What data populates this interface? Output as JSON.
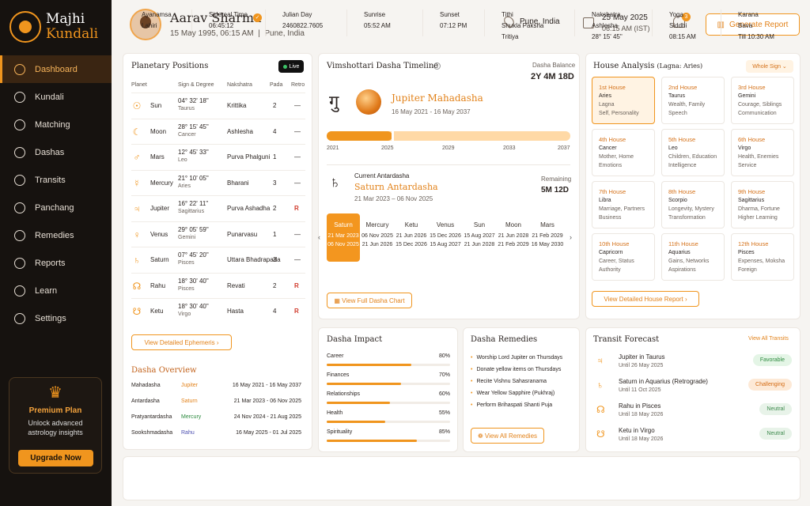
{
  "brand": {
    "line1": "Majhi",
    "line2": "Kundali"
  },
  "nav": [
    {
      "label": "Dashboard"
    },
    {
      "label": "Kundali"
    },
    {
      "label": "Matching"
    },
    {
      "label": "Dashas"
    },
    {
      "label": "Transits"
    },
    {
      "label": "Panchang"
    },
    {
      "label": "Remedies"
    },
    {
      "label": "Reports"
    },
    {
      "label": "Learn"
    },
    {
      "label": "Settings"
    }
  ],
  "premium": {
    "title": "Premium Plan",
    "sub1": "Unlock advanced",
    "sub2": "astrology insights",
    "btn": "Upgrade Now"
  },
  "user": {
    "name": "Aarav Sharma",
    "dob": "15 May 1995, 06:15 AM",
    "place": "Pune, India"
  },
  "header": {
    "location": "Pune, India",
    "date": "25 May 2025",
    "time": "06:15 AM (IST)",
    "notif": "3",
    "report_btn": "Generate Report"
  },
  "planets": {
    "title": "Planetary Positions",
    "live": "Live",
    "cols": [
      "Planet",
      "Sign & Degree",
      "Nakshatra",
      "Pada",
      "Retro"
    ],
    "rows": [
      {
        "icon": "☉",
        "name": "Sun",
        "deg": "04° 32' 18\"",
        "sign": "Taurus",
        "nak": "Krittika",
        "pada": "2",
        "retro": "—"
      },
      {
        "icon": "☾",
        "name": "Moon",
        "deg": "28° 15' 45\"",
        "sign": "Cancer",
        "nak": "Ashlesha",
        "pada": "4",
        "retro": "—"
      },
      {
        "icon": "♂",
        "name": "Mars",
        "deg": "12° 45' 33\"",
        "sign": "Leo",
        "nak": "Purva Phalguni",
        "pada": "1",
        "retro": "—"
      },
      {
        "icon": "☿",
        "name": "Mercury",
        "deg": "21° 10' 05\"",
        "sign": "Aries",
        "nak": "Bharani",
        "pada": "3",
        "retro": "—"
      },
      {
        "icon": "♃",
        "name": "Jupiter",
        "deg": "16° 22' 11\"",
        "sign": "Sagittarius",
        "nak": "Purva Ashadha",
        "pada": "2",
        "retro": "R"
      },
      {
        "icon": "♀",
        "name": "Venus",
        "deg": "29° 05' 59\"",
        "sign": "Gemini",
        "nak": "Punarvasu",
        "pada": "1",
        "retro": "—"
      },
      {
        "icon": "♄",
        "name": "Saturn",
        "deg": "07° 45' 20\"",
        "sign": "Pisces",
        "nak": "Uttara Bhadrapada",
        "pada": "3",
        "retro": "—"
      },
      {
        "icon": "☊",
        "name": "Rahu",
        "deg": "18° 30' 40\"",
        "sign": "Pisces",
        "nak": "Revati",
        "pada": "2",
        "retro": "R"
      },
      {
        "icon": "☋",
        "name": "Ketu",
        "deg": "18° 30' 40\"",
        "sign": "Virgo",
        "nak": "Hasta",
        "pada": "4",
        "retro": "R"
      }
    ],
    "ephem_btn": "View Detailed Ephemeris"
  },
  "overview": {
    "title": "Dasha Overview",
    "rows": [
      {
        "k": "Mahadasha",
        "p": "Jupiter",
        "d": "16 May 2021 - 16 May 2037",
        "c": "#e2821a"
      },
      {
        "k": "Antardasha",
        "p": "Saturn",
        "d": "21 Mar 2023 - 06 Nov 2025",
        "c": "#e2821a"
      },
      {
        "k": "Pratyantardasha",
        "p": "Mercury",
        "d": "24 Nov 2024 - 21 Aug 2025",
        "c": "#2d8a3f"
      },
      {
        "k": "Sookshmadasha",
        "p": "Rahu",
        "d": "16 May 2025 - 01 Jul 2025",
        "c": "#4c4fb0"
      }
    ]
  },
  "timeline": {
    "title": "Vimshottari Dasha Timeline",
    "bal_label": "Dasha Balance",
    "bal": "2Y 4M 18D",
    "glyph": "गु",
    "maha": "Jupiter Mahadasha",
    "maha_dates": "16 May 2021 - 16 May 2037",
    "progress": 0.27,
    "years": [
      "2021",
      "2025",
      "2029",
      "2033",
      "2037"
    ],
    "antar_label": "Current Antardasha",
    "antar_glyph": "♄",
    "antar": "Saturn Antardasha",
    "antar_dates": "21 Mar 2023 – 06 Nov 2025",
    "rem_label": "Remaining",
    "rem": "5M 12D",
    "cells": [
      {
        "n": "Saturn",
        "a": "21 Mar 2023",
        "b": "06 Nov 2025"
      },
      {
        "n": "Mercury",
        "a": "06 Nov 2025",
        "b": "21 Jun 2026"
      },
      {
        "n": "Ketu",
        "a": "21 Jun 2026",
        "b": "15 Dec 2026"
      },
      {
        "n": "Venus",
        "a": "15 Dec 2026",
        "b": "15 Aug 2027"
      },
      {
        "n": "Sun",
        "a": "15 Aug 2027",
        "b": "21 Jun 2028"
      },
      {
        "n": "Moon",
        "a": "21 Jun 2028",
        "b": "21 Feb 2029"
      },
      {
        "n": "Mars",
        "a": "21 Feb 2029",
        "b": "16 May 2030"
      }
    ],
    "full_btn": "View Full Dasha Chart"
  },
  "house": {
    "title": "House Analysis",
    "lagna": "(Lagna: Aries)",
    "select": "Whole Sign",
    "cells": [
      {
        "h": "1st House",
        "s": "Aries",
        "d1": "Lagna",
        "d2": "Self, Personality"
      },
      {
        "h": "2nd House",
        "s": "Taurus",
        "d1": "Wealth, Family",
        "d2": "Speech"
      },
      {
        "h": "3rd House",
        "s": "Gemini",
        "d1": "Courage, Siblings",
        "d2": "Communication"
      },
      {
        "h": "4th House",
        "s": "Cancer",
        "d1": "Mother, Home",
        "d2": "Emotions"
      },
      {
        "h": "5th House",
        "s": "Leo",
        "d1": "Children, Education",
        "d2": "Intelligence"
      },
      {
        "h": "6th House",
        "s": "Virgo",
        "d1": "Health, Enemies",
        "d2": "Service"
      },
      {
        "h": "7th House",
        "s": "Libra",
        "d1": "Marriage, Partners",
        "d2": "Business"
      },
      {
        "h": "8th House",
        "s": "Scorpio",
        "d1": "Longevity, Mystery",
        "d2": "Transformation"
      },
      {
        "h": "9th House",
        "s": "Sagittarius",
        "d1": "Dharma, Fortune",
        "d2": "Higher Learning"
      },
      {
        "h": "10th House",
        "s": "Capricorn",
        "d1": "Career, Status",
        "d2": "Authority"
      },
      {
        "h": "11th House",
        "s": "Aquarius",
        "d1": "Gains, Networks",
        "d2": "Aspirations"
      },
      {
        "h": "12th House",
        "s": "Pisces",
        "d1": "Expenses, Moksha",
        "d2": "Foreign"
      }
    ],
    "btn": "View Detailed House Report"
  },
  "impact": {
    "title": "Dasha Impact",
    "rows": [
      {
        "k": "Career",
        "v": 80,
        "t": "80%"
      },
      {
        "k": "Finances",
        "v": 70,
        "t": "70%"
      },
      {
        "k": "Relationships",
        "v": 60,
        "t": "60%"
      },
      {
        "k": "Health",
        "v": 55,
        "t": "55%"
      },
      {
        "k": "Spirituality",
        "v": 85,
        "t": "85%"
      }
    ]
  },
  "remedies": {
    "title": "Dasha Remedies",
    "items": [
      "Worship Lord Jupiter on Thursdays",
      "Donate yellow items on Thursdays",
      "Recite Vishnu Sahasranama",
      "Wear Yellow Sapphire (Pukhraj)",
      "Perform Brihaspati Shanti Puja"
    ],
    "btn": "View All Remedies"
  },
  "transit": {
    "title": "Transit Forecast",
    "link": "View All Transits",
    "rows": [
      {
        "icon": "♃",
        "n": "Jupiter in Taurus",
        "u": "Until 26 May 2025",
        "tag": "Favorable",
        "cls": "fav"
      },
      {
        "icon": "♄",
        "n": "Saturn in Aquarius (Retrograde)",
        "u": "Until 11 Oct 2025",
        "tag": "Challenging",
        "cls": "chal"
      },
      {
        "icon": "☊",
        "n": "Rahu in Pisces",
        "u": "Until 18 May 2026",
        "tag": "Neutral",
        "cls": "neu"
      },
      {
        "icon": "☋",
        "n": "Ketu in Virgo",
        "u": "Until 18 May 2026",
        "tag": "Neutral",
        "cls": "neu"
      }
    ]
  },
  "bottom": [
    {
      "k": "Ayanamsa",
      "v": "Lahiri"
    },
    {
      "k": "Sidereal Time",
      "v": "06:45:12"
    },
    {
      "k": "Julian Day",
      "v": "2460822.7605"
    },
    {
      "k": "Sunrise",
      "v": "05:52 AM"
    },
    {
      "k": "Sunset",
      "v": "07:12 PM"
    },
    {
      "k": "Tithi",
      "v": "Shukla Paksha",
      "v2": "Tritiya"
    },
    {
      "k": "Nakshatra",
      "v": "Ashlesha",
      "v2": "28° 15' 45\""
    },
    {
      "k": "Yoga",
      "v": "Siddhi",
      "v2": "08:15 AM"
    },
    {
      "k": "Karana",
      "v": "Bava",
      "v2": "Till 10:30 AM"
    }
  ],
  "colors": {
    "accent": "#f0951e",
    "sidebar": "#16120f"
  }
}
